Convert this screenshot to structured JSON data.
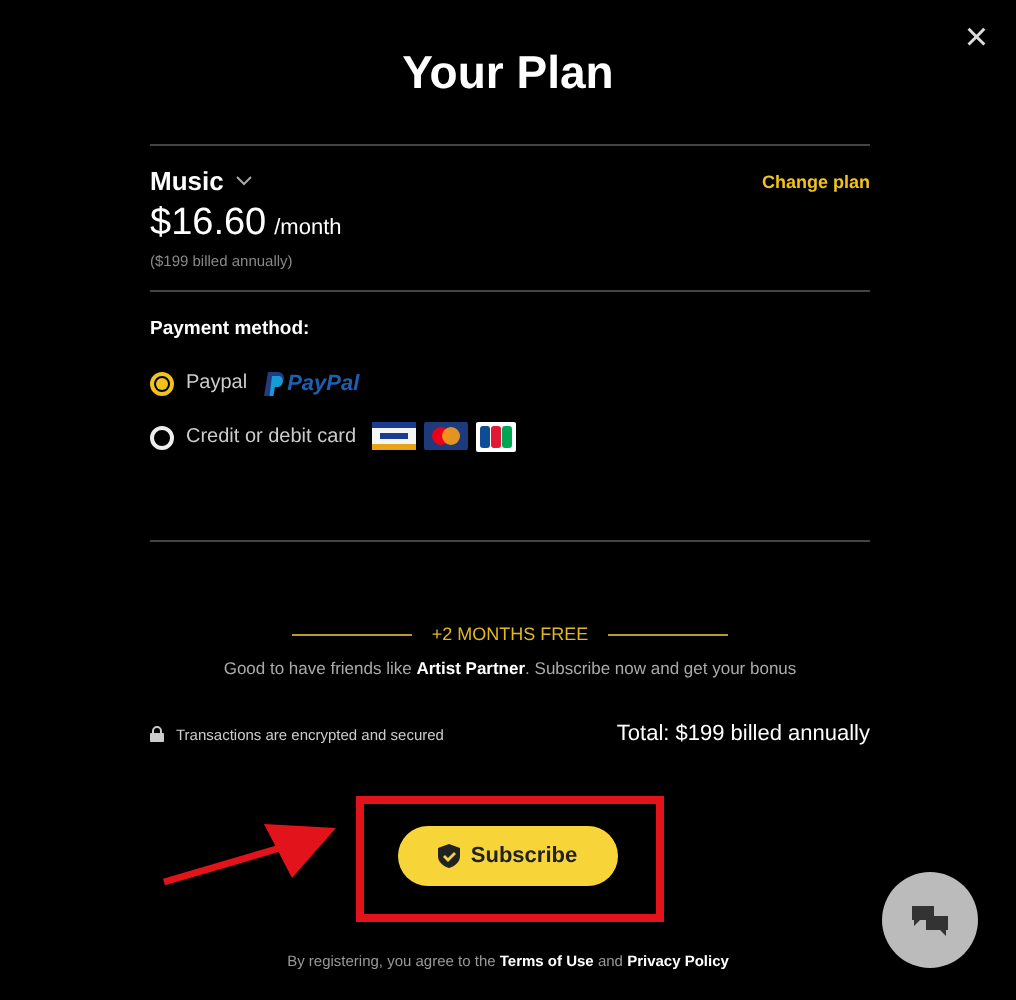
{
  "title": "Your Plan",
  "close": "×",
  "plan": {
    "name": "Music",
    "change_link": "Change plan",
    "price": "$16.60",
    "period": "/month",
    "billing_note": "($199 billed annually)"
  },
  "payment": {
    "label": "Payment method:",
    "options": [
      {
        "kind": "paypal",
        "label": "Paypal",
        "logo_text": "PayPal",
        "selected": true
      },
      {
        "kind": "card",
        "label": "Credit or debit card",
        "selected": false
      }
    ]
  },
  "promo": {
    "badge": "+2 MONTHS FREE",
    "message": "Good to have friends like **Artist Partner**. Subscribe now and get your bonus"
  },
  "security_note": "Transactions are encrypted and secured",
  "total": "Total: $199 billed annually",
  "subscribe_button": "Subscribe",
  "legal": {
    "prefix": "By registering, you agree to the",
    "terms_link": "Terms of Use",
    "middle": "and",
    "privacy_link": "Privacy Policy"
  }
}
